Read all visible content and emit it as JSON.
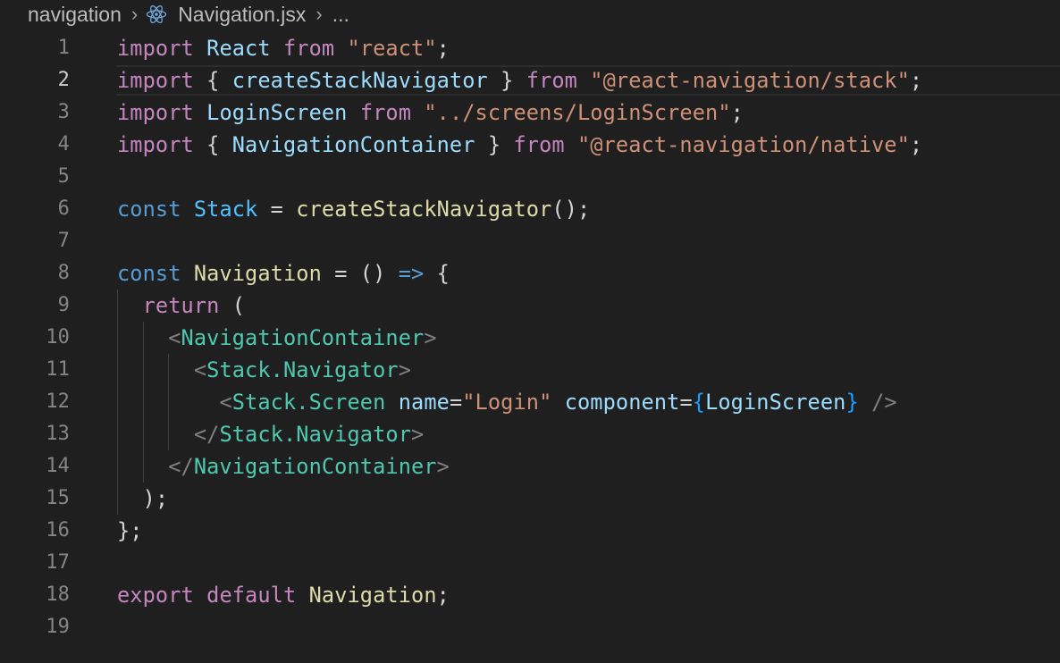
{
  "breadcrumb": {
    "folder": "navigation",
    "file": "Navigation.jsx",
    "more": "...",
    "file_icon": "react-icon"
  },
  "editor": {
    "current_line": 2,
    "lines": [
      {
        "number": "1",
        "tokens": [
          {
            "text": "import",
            "type": "kw"
          },
          {
            "text": " ",
            "type": "pl"
          },
          {
            "text": "React",
            "type": "var"
          },
          {
            "text": " ",
            "type": "pl"
          },
          {
            "text": "from",
            "type": "kw"
          },
          {
            "text": " ",
            "type": "pl"
          },
          {
            "text": "\"react\"",
            "type": "st"
          },
          {
            "text": ";",
            "type": "pl"
          }
        ]
      },
      {
        "number": "2",
        "tokens": [
          {
            "text": "import",
            "type": "kw"
          },
          {
            "text": " { ",
            "type": "pl"
          },
          {
            "text": "createStackNavigator",
            "type": "var"
          },
          {
            "text": " } ",
            "type": "pl"
          },
          {
            "text": "from",
            "type": "kw"
          },
          {
            "text": " ",
            "type": "pl"
          },
          {
            "text": "\"@react-navigation/stack\"",
            "type": "st"
          },
          {
            "text": ";",
            "type": "pl"
          }
        ]
      },
      {
        "number": "3",
        "tokens": [
          {
            "text": "import",
            "type": "kw"
          },
          {
            "text": " ",
            "type": "pl"
          },
          {
            "text": "LoginScreen",
            "type": "var"
          },
          {
            "text": " ",
            "type": "pl"
          },
          {
            "text": "from",
            "type": "kw"
          },
          {
            "text": " ",
            "type": "pl"
          },
          {
            "text": "\"../screens/LoginScreen\"",
            "type": "st"
          },
          {
            "text": ";",
            "type": "pl"
          }
        ]
      },
      {
        "number": "4",
        "tokens": [
          {
            "text": "import",
            "type": "kw"
          },
          {
            "text": " { ",
            "type": "pl"
          },
          {
            "text": "NavigationContainer",
            "type": "var"
          },
          {
            "text": " } ",
            "type": "pl"
          },
          {
            "text": "from",
            "type": "kw"
          },
          {
            "text": " ",
            "type": "pl"
          },
          {
            "text": "\"@react-navigation/native\"",
            "type": "st"
          },
          {
            "text": ";",
            "type": "pl"
          }
        ]
      },
      {
        "number": "5",
        "tokens": []
      },
      {
        "number": "6",
        "tokens": [
          {
            "text": "const",
            "type": "stor"
          },
          {
            "text": " ",
            "type": "pl"
          },
          {
            "text": "Stack",
            "type": "const"
          },
          {
            "text": " = ",
            "type": "pl"
          },
          {
            "text": "createStackNavigator",
            "type": "fn"
          },
          {
            "text": "();",
            "type": "pl"
          }
        ]
      },
      {
        "number": "7",
        "tokens": []
      },
      {
        "number": "8",
        "tokens": [
          {
            "text": "const",
            "type": "stor"
          },
          {
            "text": " ",
            "type": "pl"
          },
          {
            "text": "Navigation",
            "type": "fn"
          },
          {
            "text": " = () ",
            "type": "pl"
          },
          {
            "text": "=>",
            "type": "stor"
          },
          {
            "text": " {",
            "type": "pl"
          }
        ]
      },
      {
        "number": "9",
        "tokens": [
          {
            "text": "  ",
            "type": "pl"
          },
          {
            "text": "return",
            "type": "kw"
          },
          {
            "text": " (",
            "type": "pl"
          }
        ]
      },
      {
        "number": "10",
        "tokens": [
          {
            "text": "    ",
            "type": "pl"
          },
          {
            "text": "<",
            "type": "punc"
          },
          {
            "text": "NavigationContainer",
            "type": "tag"
          },
          {
            "text": ">",
            "type": "punc"
          }
        ]
      },
      {
        "number": "11",
        "tokens": [
          {
            "text": "      ",
            "type": "pl"
          },
          {
            "text": "<",
            "type": "punc"
          },
          {
            "text": "Stack.Navigator",
            "type": "tag"
          },
          {
            "text": ">",
            "type": "punc"
          }
        ]
      },
      {
        "number": "12",
        "tokens": [
          {
            "text": "        ",
            "type": "pl"
          },
          {
            "text": "<",
            "type": "punc"
          },
          {
            "text": "Stack.Screen",
            "type": "tag"
          },
          {
            "text": " ",
            "type": "pl"
          },
          {
            "text": "name",
            "type": "var"
          },
          {
            "text": "=",
            "type": "pl"
          },
          {
            "text": "\"Login\"",
            "type": "st"
          },
          {
            "text": " ",
            "type": "pl"
          },
          {
            "text": "component",
            "type": "var"
          },
          {
            "text": "=",
            "type": "pl"
          },
          {
            "text": "{",
            "type": "brace"
          },
          {
            "text": "LoginScreen",
            "type": "var"
          },
          {
            "text": "}",
            "type": "brace"
          },
          {
            "text": " ",
            "type": "pl"
          },
          {
            "text": "/>",
            "type": "punc"
          }
        ]
      },
      {
        "number": "13",
        "tokens": [
          {
            "text": "      ",
            "type": "pl"
          },
          {
            "text": "</",
            "type": "punc"
          },
          {
            "text": "Stack.Navigator",
            "type": "tag"
          },
          {
            "text": ">",
            "type": "punc"
          }
        ]
      },
      {
        "number": "14",
        "tokens": [
          {
            "text": "    ",
            "type": "pl"
          },
          {
            "text": "</",
            "type": "punc"
          },
          {
            "text": "NavigationContainer",
            "type": "tag"
          },
          {
            "text": ">",
            "type": "punc"
          }
        ]
      },
      {
        "number": "15",
        "tokens": [
          {
            "text": "  );",
            "type": "pl"
          }
        ]
      },
      {
        "number": "16",
        "tokens": [
          {
            "text": "};",
            "type": "pl"
          }
        ]
      },
      {
        "number": "17",
        "tokens": []
      },
      {
        "number": "18",
        "tokens": [
          {
            "text": "export",
            "type": "kw"
          },
          {
            "text": " ",
            "type": "pl"
          },
          {
            "text": "default",
            "type": "kw"
          },
          {
            "text": " ",
            "type": "pl"
          },
          {
            "text": "Navigation",
            "type": "fn"
          },
          {
            "text": ";",
            "type": "pl"
          }
        ]
      },
      {
        "number": "19",
        "tokens": []
      }
    ]
  }
}
